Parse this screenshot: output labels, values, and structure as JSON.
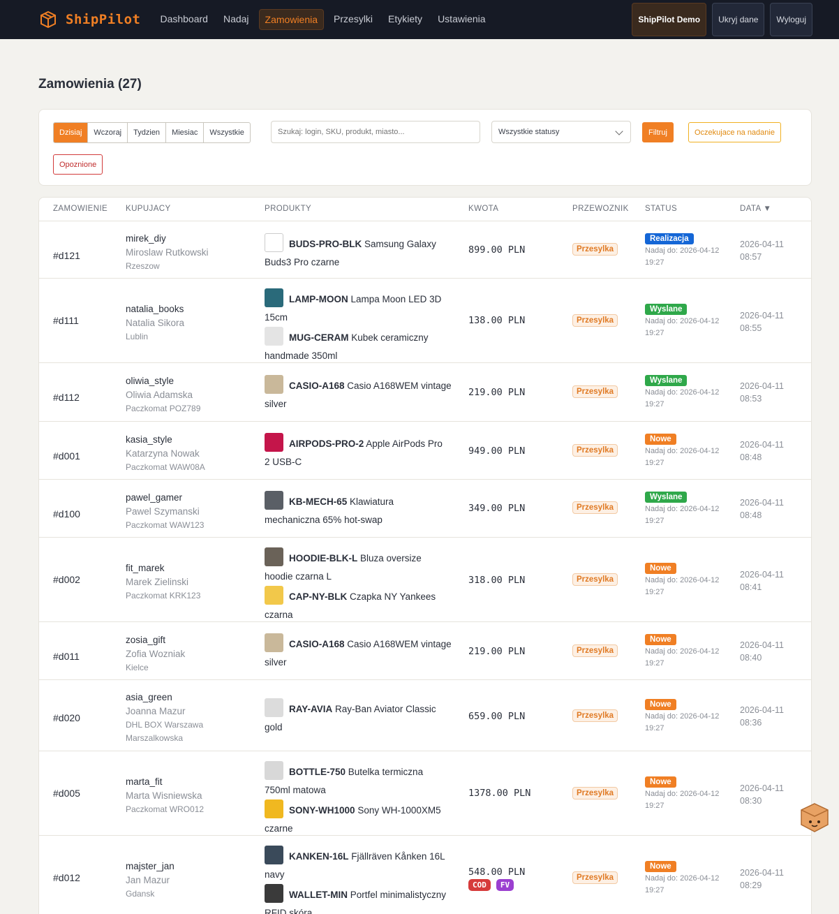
{
  "app": {
    "name": "ShipPilot"
  },
  "nav": [
    "Dashboard",
    "Nadaj",
    "Zamowienia",
    "Przesylki",
    "Etykiety",
    "Ustawienia"
  ],
  "nav_active": "Zamowienia",
  "topbar": {
    "demo": "ShipPilot Demo",
    "hide": "Ukryj dane",
    "logout": "Wyloguj"
  },
  "page_title": "Zamowienia (27)",
  "filters": {
    "ranges": [
      "Dzisiaj",
      "Wczoraj",
      "Tydzien",
      "Miesiac",
      "Wszystkie"
    ],
    "active_range": "Dzisiaj",
    "search_placeholder": "Szukaj: login, SKU, produkt, miasto...",
    "status_select": "Wszystkie statusy",
    "filter_btn": "Filtruj",
    "waiting_btn": "Oczekujace na nadanie",
    "late_btn": "Opoznione"
  },
  "columns": {
    "order": "ZAMOWIENIE",
    "buyer": "KUPUJACY",
    "products": "PRODUKTY",
    "amount": "KWOTA",
    "carrier": "PRZEWOZNIK",
    "status": "STATUS",
    "date": "DATA ▼"
  },
  "colors": {
    "accent": "#f07f24",
    "realizacja": "#1466d6",
    "wyslane": "#2fa84a",
    "nowe": "#f07f24"
  },
  "orders": [
    {
      "id": "#d121",
      "login": "mirek_diy",
      "name": "Miroslaw Rutkowski",
      "loc": [
        "Rzeszow"
      ],
      "products": [
        {
          "sku": "BUDS-PRO-BLK",
          "desc": "Samsung Galaxy",
          "desc2": "Buds3 Pro czarne",
          "thumb": "#ffffff"
        }
      ],
      "amount": "899.00 PLN",
      "carrier": "Przesylka",
      "status": "Realizacja",
      "due": [
        "Nadaj do: 2026-04-12",
        "19:27"
      ],
      "date": [
        "2026-04-11",
        "08:57"
      ]
    },
    {
      "id": "#d111",
      "login": "natalia_books",
      "name": "Natalia Sikora",
      "loc": [
        "Lublin"
      ],
      "products": [
        {
          "sku": "LAMP-MOON",
          "desc": "Lampa Moon LED 3D",
          "desc2": "15cm",
          "thumb": "#2a6a7a"
        },
        {
          "sku": "MUG-CERAM",
          "desc": "Kubek ceramiczny",
          "desc2": "handmade 350ml",
          "thumb": "#e4e4e4"
        }
      ],
      "amount": "138.00 PLN",
      "carrier": "Przesylka",
      "status": "Wyslane",
      "due": [
        "Nadaj do: 2026-04-12",
        "19:27"
      ],
      "date": [
        "2026-04-11",
        "08:55"
      ]
    },
    {
      "id": "#d112",
      "login": "oliwia_style",
      "name": "Oliwia Adamska",
      "loc": [
        "Paczkomat POZ789"
      ],
      "products": [
        {
          "sku": "CASIO-A168",
          "desc": "Casio A168WEM vintage",
          "desc2": "silver",
          "thumb": "#c9b89a"
        }
      ],
      "amount": "219.00 PLN",
      "carrier": "Przesylka",
      "status": "Wyslane",
      "due": [
        "Nadaj do: 2026-04-12",
        "19:27"
      ],
      "date": [
        "2026-04-11",
        "08:53"
      ]
    },
    {
      "id": "#d001",
      "login": "kasia_style",
      "name": "Katarzyna Nowak",
      "loc": [
        "Paczkomat WAW08A"
      ],
      "products": [
        {
          "sku": "AIRPODS-PRO-2",
          "desc": "Apple AirPods Pro",
          "desc2": "2 USB-C",
          "thumb": "#c4154a"
        }
      ],
      "amount": "949.00 PLN",
      "carrier": "Przesylka",
      "status": "Nowe",
      "due": [
        "Nadaj do: 2026-04-12",
        "19:27"
      ],
      "date": [
        "2026-04-11",
        "08:48"
      ]
    },
    {
      "id": "#d100",
      "login": "pawel_gamer",
      "name": "Pawel Szymanski",
      "loc": [
        "Paczkomat WAW123"
      ],
      "products": [
        {
          "sku": "KB-MECH-65",
          "desc": "Klawiatura",
          "desc2": "mechaniczna 65% hot-swap",
          "thumb": "#5a5f66"
        }
      ],
      "amount": "349.00 PLN",
      "carrier": "Przesylka",
      "status": "Wyslane",
      "due": [
        "Nadaj do: 2026-04-12",
        "19:27"
      ],
      "date": [
        "2026-04-11",
        "08:48"
      ]
    },
    {
      "id": "#d002",
      "login": "fit_marek",
      "name": "Marek Zielinski",
      "loc": [
        "Paczkomat KRK123"
      ],
      "products": [
        {
          "sku": "HOODIE-BLK-L",
          "desc": "Bluza oversize",
          "desc2": "hoodie czarna L",
          "thumb": "#6a6258"
        },
        {
          "sku": "CAP-NY-BLK",
          "desc": "Czapka NY Yankees",
          "desc2": "czarna",
          "thumb": "#f2c84a"
        }
      ],
      "amount": "318.00 PLN",
      "carrier": "Przesylka",
      "status": "Nowe",
      "due": [
        "Nadaj do: 2026-04-12",
        "19:27"
      ],
      "date": [
        "2026-04-11",
        "08:41"
      ]
    },
    {
      "id": "#d011",
      "login": "zosia_gift",
      "name": "Zofia Wozniak",
      "loc": [
        "Kielce"
      ],
      "products": [
        {
          "sku": "CASIO-A168",
          "desc": "Casio A168WEM vintage",
          "desc2": "silver",
          "thumb": "#c9b89a"
        }
      ],
      "amount": "219.00 PLN",
      "carrier": "Przesylka",
      "status": "Nowe",
      "due": [
        "Nadaj do: 2026-04-12",
        "19:27"
      ],
      "date": [
        "2026-04-11",
        "08:40"
      ]
    },
    {
      "id": "#d020",
      "login": "asia_green",
      "name": "Joanna Mazur",
      "loc": [
        "DHL BOX Warszawa",
        "Marszalkowska"
      ],
      "products": [
        {
          "sku": "RAY-AVIA",
          "desc": "Ray-Ban Aviator Classic",
          "desc2": "gold",
          "thumb": "#dcdcdc"
        }
      ],
      "amount": "659.00 PLN",
      "carrier": "Przesylka",
      "status": "Nowe",
      "due": [
        "Nadaj do: 2026-04-12",
        "19:27"
      ],
      "date": [
        "2026-04-11",
        "08:36"
      ]
    },
    {
      "id": "#d005",
      "login": "marta_fit",
      "name": "Marta Wisniewska",
      "loc": [
        "Paczkomat WRO012"
      ],
      "products": [
        {
          "sku": "BOTTLE-750",
          "desc": "Butelka termiczna",
          "desc2": "750ml matowa",
          "thumb": "#d8d8d8"
        },
        {
          "sku": "SONY-WH1000",
          "desc": "Sony WH-1000XM5",
          "desc2": "czarne",
          "thumb": "#f0b820"
        }
      ],
      "amount": "1378.00 PLN",
      "carrier": "Przesylka",
      "status": "Nowe",
      "due": [
        "Nadaj do: 2026-04-12",
        "19:27"
      ],
      "date": [
        "2026-04-11",
        "08:30"
      ]
    },
    {
      "id": "#d012",
      "login": "majster_jan",
      "name": "Jan Mazur",
      "loc": [
        "Gdansk"
      ],
      "products": [
        {
          "sku": "KANKEN-16L",
          "desc": "Fjällräven Kånken 16L",
          "desc2": "navy",
          "thumb": "#3a4a5a"
        },
        {
          "sku": "WALLET-MIN",
          "desc": "Portfel minimalistyczny",
          "desc2": "RFID skóra",
          "thumb": "#3a3a3a"
        }
      ],
      "amount": "548.00 PLN",
      "tags": [
        "COD",
        "FV"
      ],
      "carrier": "Przesylka",
      "status": "Nowe",
      "due": [
        "Nadaj do: 2026-04-12",
        "19:27"
      ],
      "date": [
        "2026-04-11",
        "08:29"
      ]
    }
  ]
}
